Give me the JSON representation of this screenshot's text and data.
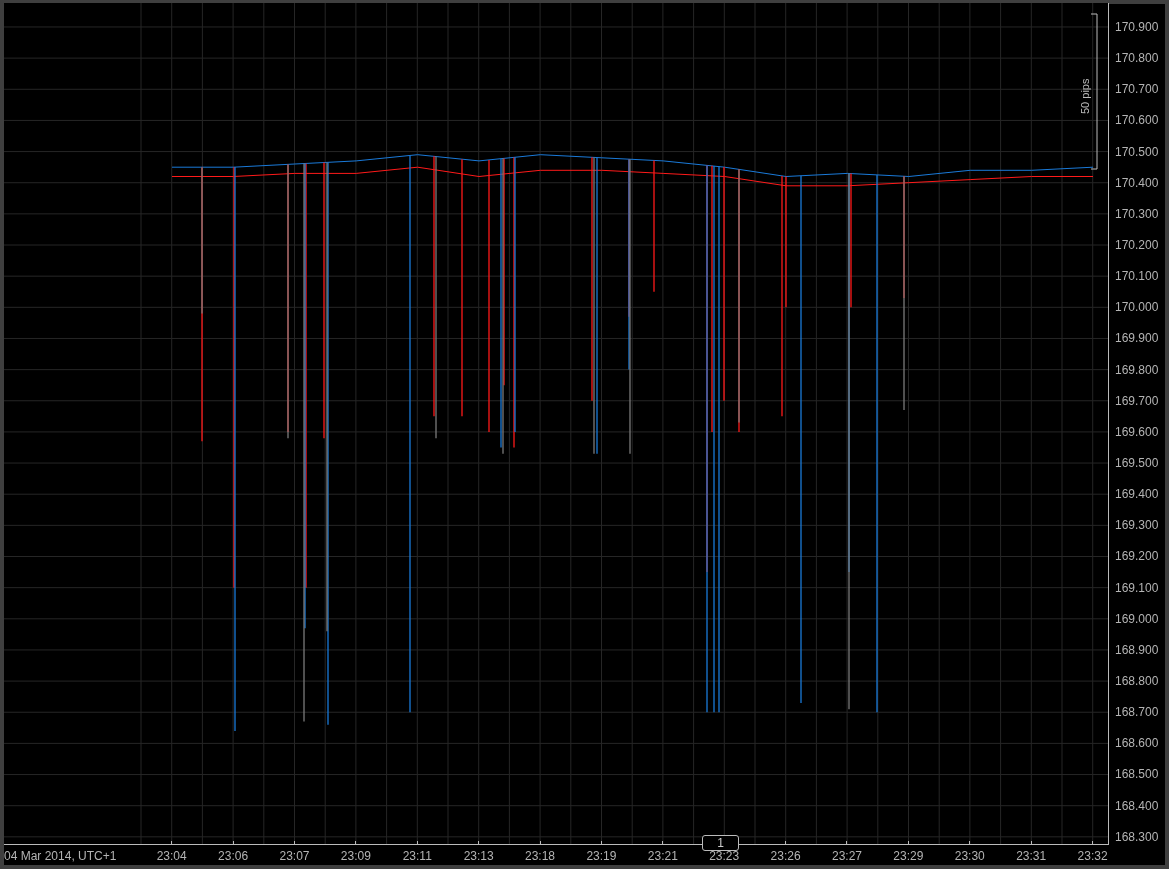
{
  "chart_data": {
    "type": "line",
    "categories": [
      "23:04",
      "23:06",
      "23:07",
      "23:09",
      "23:11",
      "23:13",
      "23:18",
      "23:19",
      "23:21",
      "23:23",
      "23:26",
      "23:27",
      "23:29",
      "23:30",
      "23:31",
      "23:32"
    ],
    "series": [
      {
        "color": "#1a7ad9",
        "values": [
          170.45,
          170.45,
          170.46,
          170.47,
          170.49,
          170.47,
          170.49,
          170.48,
          170.47,
          170.45,
          170.42,
          170.43,
          170.42,
          170.44,
          170.44,
          170.45
        ]
      },
      {
        "color": "#ff1a1a",
        "values": [
          170.42,
          170.42,
          170.43,
          170.43,
          170.45,
          170.42,
          170.44,
          170.44,
          170.43,
          170.42,
          170.39,
          170.39,
          170.4,
          170.41,
          170.42,
          170.42
        ]
      }
    ],
    "ylim": [
      168.277,
      170.977
    ],
    "grid": true,
    "yticks": [
      {
        "value": 170.9,
        "label": "170.900"
      },
      {
        "value": 170.8,
        "label": "170.800"
      },
      {
        "value": 170.7,
        "label": "170.700"
      },
      {
        "value": 170.6,
        "label": "170.600"
      },
      {
        "value": 170.5,
        "label": "170.500"
      },
      {
        "value": 170.4,
        "label": "170.400"
      },
      {
        "value": 170.3,
        "label": "170.300"
      },
      {
        "value": 170.2,
        "label": "170.200"
      },
      {
        "value": 170.1,
        "label": "170.100"
      },
      {
        "value": 170.0,
        "label": "170.000"
      },
      {
        "value": 169.9,
        "label": "169.900"
      },
      {
        "value": 169.8,
        "label": "169.800"
      },
      {
        "value": 169.7,
        "label": "169.700"
      },
      {
        "value": 169.6,
        "label": "169.600"
      },
      {
        "value": 169.5,
        "label": "169.500"
      },
      {
        "value": 169.4,
        "label": "169.400"
      },
      {
        "value": 169.3,
        "label": "169.300"
      },
      {
        "value": 169.2,
        "label": "169.200"
      },
      {
        "value": 169.1,
        "label": "169.100"
      },
      {
        "value": 169.0,
        "label": "169.000"
      },
      {
        "value": 168.9,
        "label": "168.900"
      },
      {
        "value": 168.8,
        "label": "168.800"
      },
      {
        "value": 168.7,
        "label": "168.700"
      },
      {
        "value": 168.6,
        "label": "168.600"
      },
      {
        "value": 168.5,
        "label": "168.500"
      },
      {
        "value": 168.4,
        "label": "168.400"
      },
      {
        "value": 168.3,
        "label": "168.300"
      }
    ]
  },
  "x_axis": {
    "date_label": "04 Mar 2014, UTC+1"
  },
  "measure": {
    "label": "50 pips"
  },
  "marker": {
    "label": "1"
  }
}
